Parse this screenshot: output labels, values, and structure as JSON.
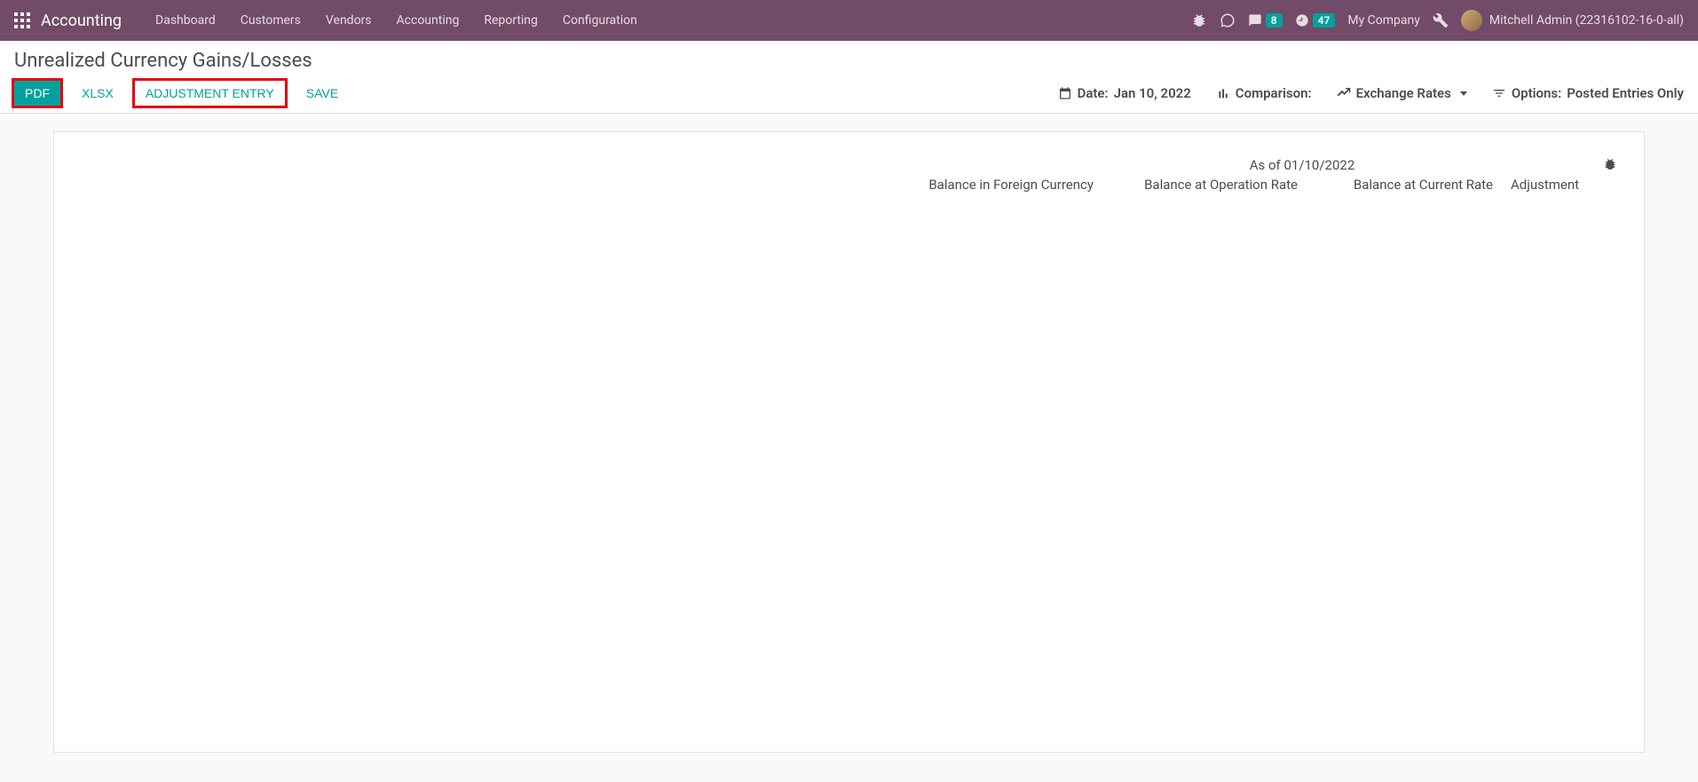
{
  "navbar": {
    "brand": "Accounting",
    "items": [
      "Dashboard",
      "Customers",
      "Vendors",
      "Accounting",
      "Reporting",
      "Configuration"
    ],
    "messages_badge": "8",
    "activities_badge": "47",
    "company": "My Company",
    "user": "Mitchell Admin (22316102-16-0-all)"
  },
  "page": {
    "title": "Unrealized Currency Gains/Losses"
  },
  "actions": {
    "pdf": "PDF",
    "xlsx": "XLSX",
    "adjustment_entry": "ADJUSTMENT ENTRY",
    "save": "SAVE"
  },
  "filters": {
    "date_label": "Date: ",
    "date_value": "Jan 10, 2022",
    "comparison_label": "Comparison:",
    "exchange_rates_label": "Exchange Rates",
    "options_label": "Options:",
    "options_value": "Posted Entries Only"
  },
  "report": {
    "as_of": "As of 01/10/2022",
    "columns": {
      "balance_foreign": "Balance in Foreign Currency",
      "balance_operation": "Balance at Operation Rate",
      "balance_current": "Balance at Current Rate",
      "adjustment": "Adjustment"
    }
  }
}
